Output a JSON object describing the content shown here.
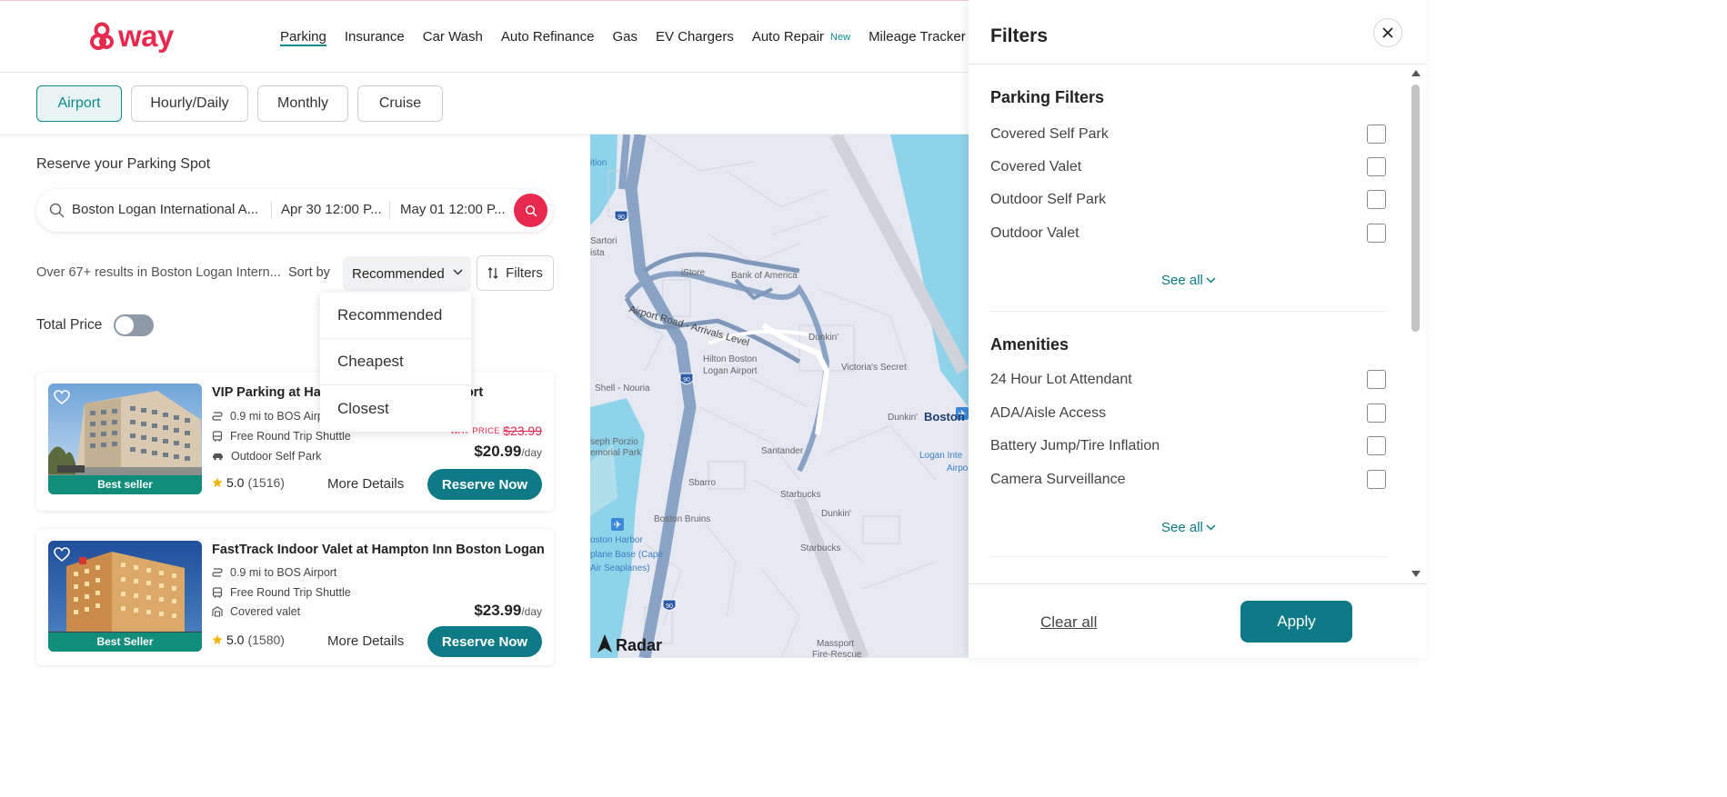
{
  "brand": {
    "name": "way",
    "color": "#e8294e",
    "accent": "#0e7a86"
  },
  "nav": {
    "items": [
      {
        "label": "Parking",
        "active": true
      },
      {
        "label": "Insurance"
      },
      {
        "label": "Car Wash"
      },
      {
        "label": "Auto Refinance"
      },
      {
        "label": "Gas"
      },
      {
        "label": "EV Chargers"
      },
      {
        "label": "Auto Repair",
        "badge": "New"
      },
      {
        "label": "Mileage Tracker"
      }
    ]
  },
  "tabs": [
    {
      "label": "Airport",
      "active": true
    },
    {
      "label": "Hourly/Daily"
    },
    {
      "label": "Monthly"
    },
    {
      "label": "Cruise"
    }
  ],
  "search": {
    "heading": "Reserve your Parking Spot",
    "location": "Boston Logan International A...",
    "start": "Apr 30 12:00 P...",
    "end": "May 01 12:00 P..."
  },
  "results": {
    "summary": "Over 67+ results in Boston Logan Intern...",
    "sort_label": "Sort by",
    "sort_value": "Recommended",
    "filters_label": "Filters",
    "total_price_label": "Total Price",
    "total_price_on": false
  },
  "sort_options": [
    "Recommended",
    "Cheapest",
    "Closest"
  ],
  "listings": [
    {
      "name": "VIP Parking at Ha",
      "name_end": "Airport",
      "distance": "0.9 mi to BOS Airp",
      "shuttle": "Free Round Trip Shuttle",
      "type": "Outdoor Self Park",
      "badge": "Best seller",
      "way_price_label": "WAY PRICE",
      "old_price": "$23.99",
      "price": "$20.99",
      "unit": "/day",
      "rating": "5.0",
      "reviews": "(1516)",
      "more_label": "More Details",
      "reserve_label": "Reserve Now"
    },
    {
      "name": "FastTrack Indoor Valet at Hampton Inn Boston Logan",
      "distance": "0.9 mi to BOS Airport",
      "shuttle": "Free Round Trip Shuttle",
      "type": "Covered valet",
      "badge": "Best Seller",
      "price": "$23.99",
      "unit": "/day",
      "rating": "5.0",
      "reviews": "(1580)",
      "more_label": "More Details",
      "reserve_label": "Reserve Now"
    }
  ],
  "map": {
    "labels": {
      "ition": "ition",
      "sartori": "Sartori",
      "ista": "ista",
      "istore": "iStore",
      "boa": "Bank of America",
      "airport_road": "Airport Road - Arrivals Level",
      "dunkin1": "Dunkin'",
      "hilton1": "Hilton Boston",
      "hilton2": "Logan Airport",
      "victoria": "Victoria's Secret",
      "shell": "Shell - Nouria",
      "dunkin2": "Dunkin'",
      "boston": "Boston",
      "logan1": "Logan Inte",
      "logan2": "Airpo",
      "porzio1": "seph Porzio",
      "porzio2": "emorial Park",
      "santander": "Santander",
      "sbarro": "Sbarro",
      "starbucks1": "Starbucks",
      "dunkin3": "Dunkin'",
      "bruins": "Boston Bruins",
      "harbor1": "oston Harbor",
      "harbor2": "plane Base (Cape",
      "harbor3": "Air Seaplanes)",
      "starbucks2": "Starbucks",
      "massport1": "Massport",
      "massport2": "Fire-Rescue",
      "radar": "Radar",
      "i90a": "90",
      "i90b": "90",
      "i90c": "90"
    }
  },
  "filters": {
    "title": "Filters",
    "sections": [
      {
        "title": "Parking Filters",
        "options": [
          "Covered Self Park",
          "Covered Valet",
          "Outdoor Self Park",
          "Outdoor Valet"
        ],
        "see_all": "See all"
      },
      {
        "title": "Amenities",
        "options": [
          "24 Hour Lot Attendant",
          "ADA/Aisle Access",
          "Battery Jump/Tire Inflation",
          "Camera Surveillance"
        ],
        "see_all": "See all"
      }
    ],
    "clear_label": "Clear all",
    "apply_label": "Apply"
  }
}
